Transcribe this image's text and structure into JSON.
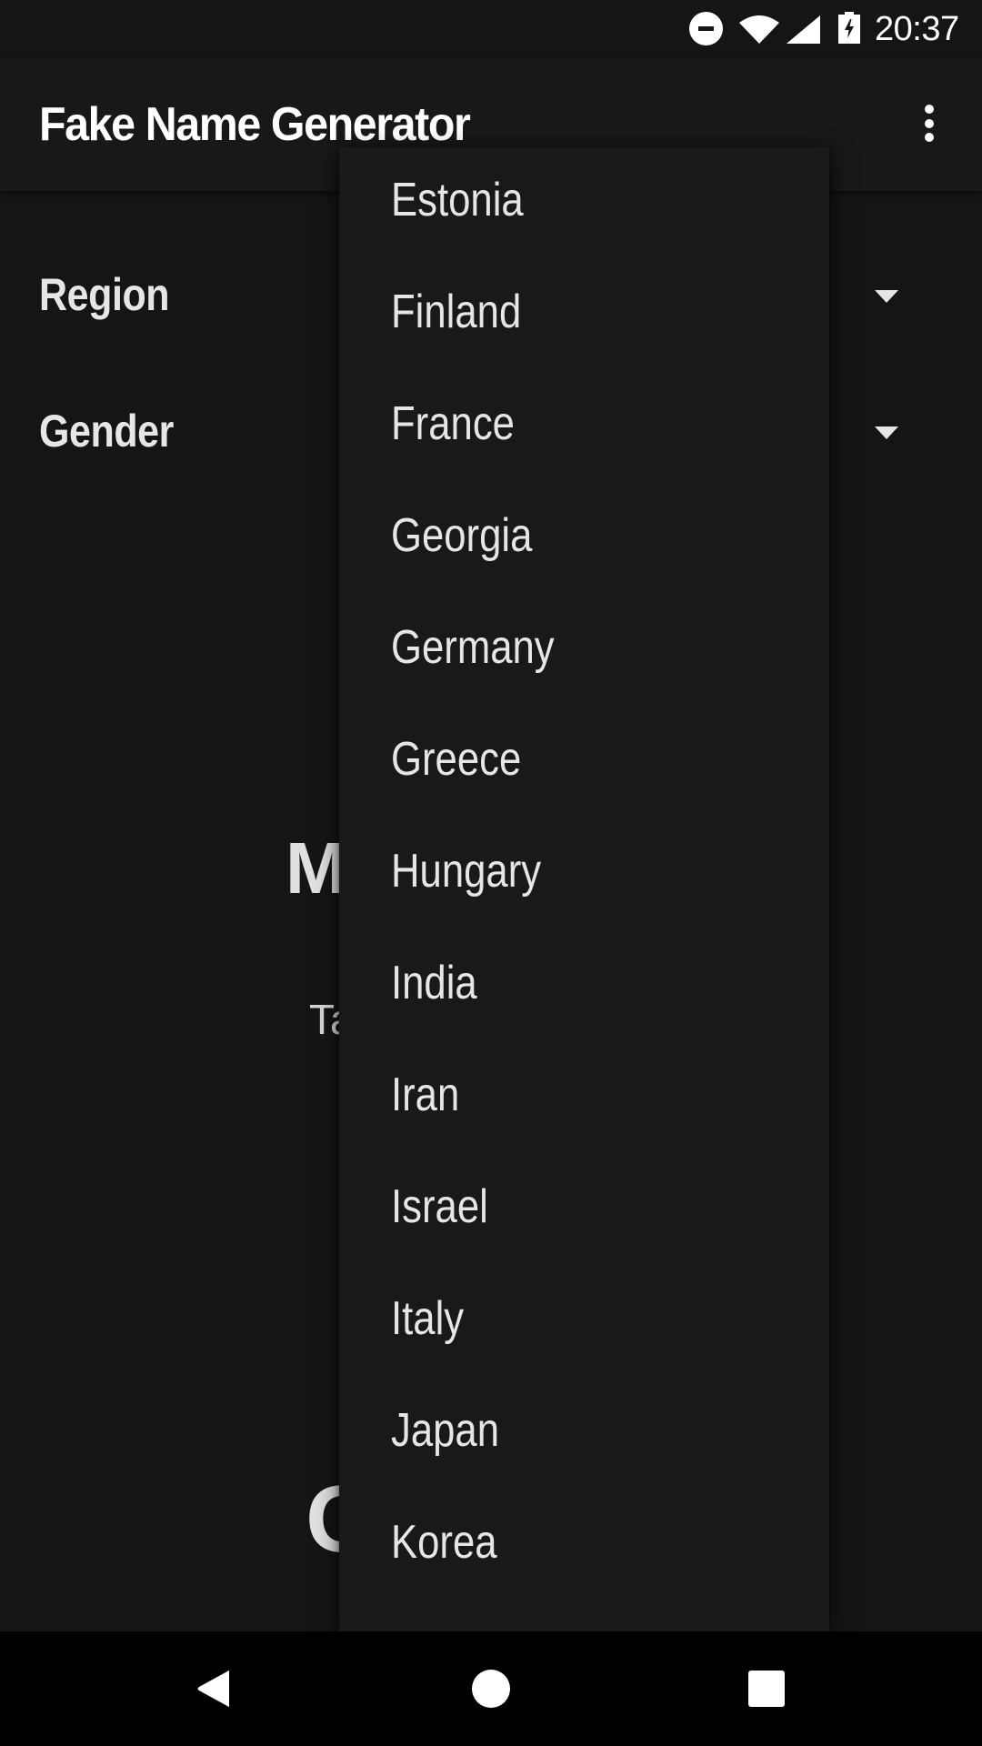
{
  "status_bar": {
    "icons": [
      "do-not-disturb-icon",
      "wifi-icon",
      "cell-signal-icon",
      "battery-charging-icon"
    ],
    "time": "20:37"
  },
  "toolbar": {
    "title": "Fake Name Generator",
    "overflow_icon": "more-vert-icon"
  },
  "form": {
    "region_label": "Region",
    "gender_label": "Gender"
  },
  "background_content": {
    "name_initial": "M",
    "subtitle_fragment": "Ta",
    "letter_fragment": "G"
  },
  "region_dropdown": {
    "items": [
      "Estonia",
      "Finland",
      "France",
      "Georgia",
      "Germany",
      "Greece",
      "Hungary",
      "India",
      "Iran",
      "Israel",
      "Italy",
      "Japan",
      "Korea"
    ]
  },
  "nav_bar": {
    "buttons": [
      "back",
      "home",
      "recents"
    ]
  },
  "colors": {
    "background": "#151515",
    "toolbar": "#181818",
    "popup": "#191919",
    "text": "#e6e6e6",
    "navbar": "#000000"
  }
}
